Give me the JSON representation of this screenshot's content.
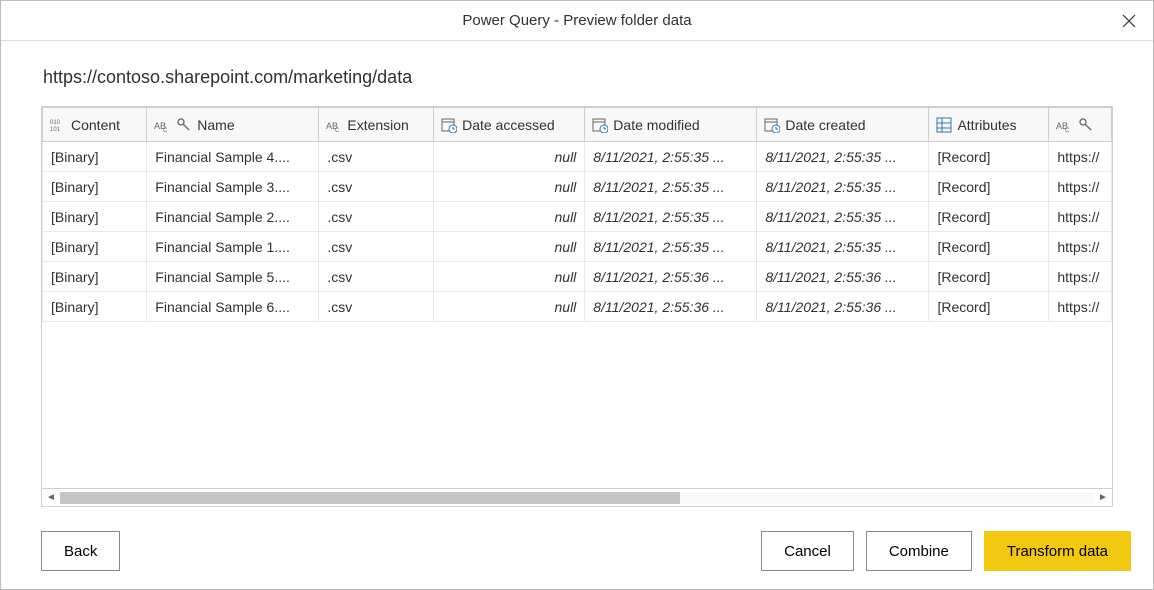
{
  "window": {
    "title": "Power Query - Preview folder data"
  },
  "breadcrumb": "https://contoso.sharepoint.com/marketing/data",
  "columns": {
    "content": "Content",
    "name": "Name",
    "extension": "Extension",
    "date_accessed": "Date accessed",
    "date_modified": "Date modified",
    "date_created": "Date created",
    "attributes": "Attributes"
  },
  "rows": [
    {
      "content": "[Binary]",
      "name": "Financial Sample 4....",
      "ext": ".csv",
      "accessed": "null",
      "modified": "8/11/2021, 2:55:35 ...",
      "created": "8/11/2021, 2:55:35 ...",
      "attributes": "[Record]",
      "path": "https://"
    },
    {
      "content": "[Binary]",
      "name": "Financial Sample 3....",
      "ext": ".csv",
      "accessed": "null",
      "modified": "8/11/2021, 2:55:35 ...",
      "created": "8/11/2021, 2:55:35 ...",
      "attributes": "[Record]",
      "path": "https://"
    },
    {
      "content": "[Binary]",
      "name": "Financial Sample 2....",
      "ext": ".csv",
      "accessed": "null",
      "modified": "8/11/2021, 2:55:35 ...",
      "created": "8/11/2021, 2:55:35 ...",
      "attributes": "[Record]",
      "path": "https://"
    },
    {
      "content": "[Binary]",
      "name": "Financial Sample 1....",
      "ext": ".csv",
      "accessed": "null",
      "modified": "8/11/2021, 2:55:35 ...",
      "created": "8/11/2021, 2:55:35 ...",
      "attributes": "[Record]",
      "path": "https://"
    },
    {
      "content": "[Binary]",
      "name": "Financial Sample 5....",
      "ext": ".csv",
      "accessed": "null",
      "modified": "8/11/2021, 2:55:36 ...",
      "created": "8/11/2021, 2:55:36 ...",
      "attributes": "[Record]",
      "path": "https://"
    },
    {
      "content": "[Binary]",
      "name": "Financial Sample 6....",
      "ext": ".csv",
      "accessed": "null",
      "modified": "8/11/2021, 2:55:36 ...",
      "created": "8/11/2021, 2:55:36 ...",
      "attributes": "[Record]",
      "path": "https://"
    }
  ],
  "buttons": {
    "back": "Back",
    "cancel": "Cancel",
    "combine": "Combine",
    "transform": "Transform data"
  }
}
